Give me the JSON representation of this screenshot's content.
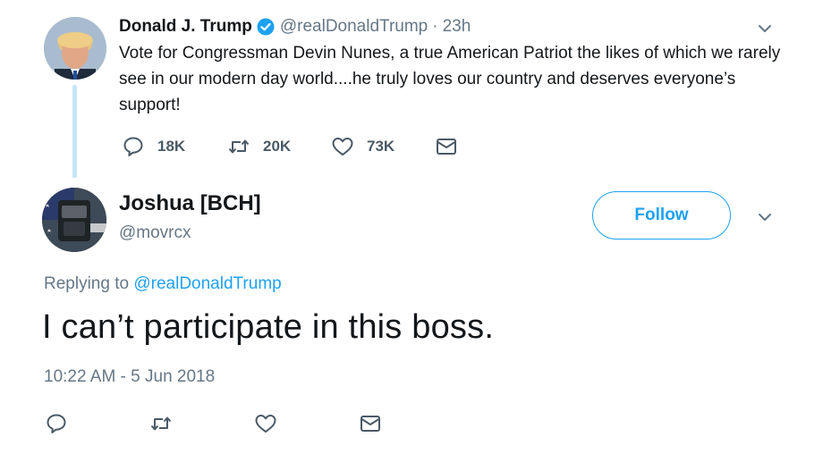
{
  "parent_tweet": {
    "name": "Donald J. Trump",
    "handle": "@realDonaldTrump",
    "separator": "·",
    "time": "23h",
    "text": "Vote for Congressman Devin Nunes, a true American Patriot the likes of which we rarely see in our modern day world....he truly loves our country and deserves everyone’s support!",
    "replies": "18K",
    "retweets": "20K",
    "likes": "73K"
  },
  "reply_tweet": {
    "name": "Joshua [BCH]",
    "handle": "@movrcx",
    "follow_label": "Follow",
    "replying_prefix": "Replying to",
    "replying_to": "@realDonaldTrump",
    "text": "I can’t participate in this boss.",
    "timestamp": "10:22 AM - 5 Jun 2018"
  },
  "colors": {
    "accent": "#1da1f2",
    "secondary_text": "#657786",
    "primary_text": "#14171a",
    "thread_line": "#c5e5f9"
  },
  "icons": {
    "reply": "speech-bubble-icon",
    "retweet": "retweet-arrows-icon",
    "like": "heart-icon",
    "dm": "envelope-icon",
    "menu": "chevron-down-icon",
    "verified": "verified-badge-icon"
  }
}
